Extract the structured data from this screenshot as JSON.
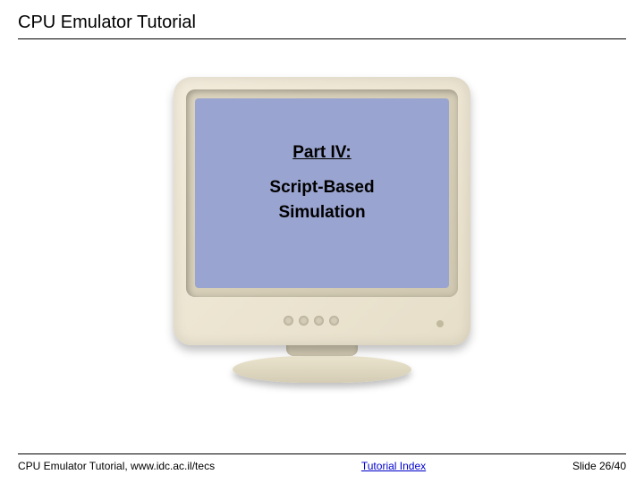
{
  "header": {
    "title": "CPU Emulator Tutorial"
  },
  "screen": {
    "part": "Part IV:",
    "line1": "Script-Based",
    "line2": "Simulation"
  },
  "footer": {
    "credit": "CPU Emulator Tutorial, www.idc.ac.il/tecs",
    "index_label": "Tutorial Index",
    "slide": "Slide 26/40"
  }
}
